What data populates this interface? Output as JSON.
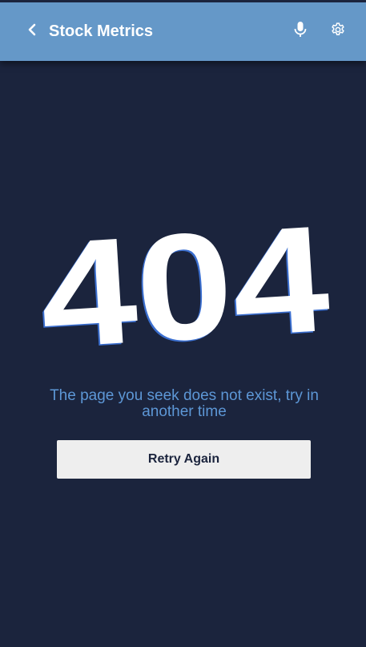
{
  "header": {
    "title": "Stock Metrics",
    "back_icon": "chevron-left-icon",
    "mic_icon": "microphone-icon",
    "settings_icon": "gear-icon"
  },
  "error": {
    "code": "404",
    "message": "The page you seek does not exist, try in another time",
    "retry_label": "Retry Again"
  },
  "colors": {
    "background": "#1b243d",
    "app_bar": "#6598c8",
    "message_text": "#5d97d6",
    "button_bg": "#eeeeee"
  }
}
